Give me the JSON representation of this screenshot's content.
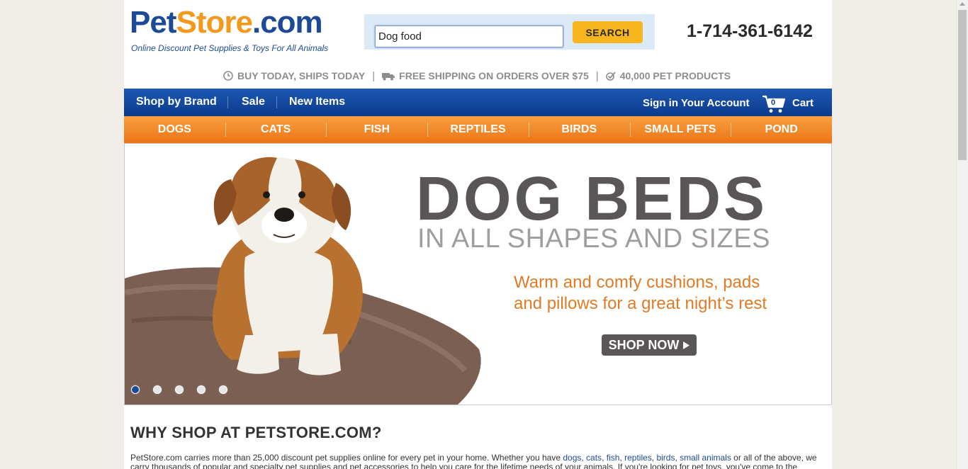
{
  "header": {
    "logo": {
      "pet": "Pet",
      "store": "Store",
      "dotcom": ".com"
    },
    "tagline": "Online Discount Pet Supplies & Toys For All Animals",
    "search": {
      "value": "Dog food",
      "button_label": "SEARCH"
    },
    "phone": "1-714-361-6142"
  },
  "promo": [
    {
      "icon": "clock-icon",
      "label": "BUY TODAY, SHIPS TODAY"
    },
    {
      "icon": "truck-icon",
      "label": "FREE SHIPPING ON ORDERS OVER $75"
    },
    {
      "icon": "checkmark-icon",
      "label": "40,000 PET PRODUCTS"
    }
  ],
  "top_nav": {
    "links": [
      "Shop by Brand",
      "Sale",
      "New Items"
    ],
    "account": "Sign in Your Account",
    "cart_count": "0",
    "cart_label": "Cart"
  },
  "categories": [
    "DOGS",
    "CATS",
    "FISH",
    "REPTILES",
    "BIRDS",
    "SMALL PETS",
    "POND"
  ],
  "hero": {
    "headline": "DOG BEDS",
    "subhead": "IN ALL SHAPES AND SIZES",
    "copy_line1": "Warm and comfy cushions, pads",
    "copy_line2": "and pillows for a great night’s rest",
    "cta": "SHOP NOW",
    "slides_total": 5,
    "active_slide": 1
  },
  "why": {
    "heading": "WHY SHOP AT PETSTORE.COM?",
    "intro": "PetStore.com carries more than 25,000 discount pet supplies online for every pet in your home. Whether you have",
    "links": [
      "dogs",
      "cats",
      "fish",
      "reptiles",
      "birds",
      "small animals"
    ],
    "outro": "or all of the above,",
    "line2": "we carry thousands of popular and specialty pet supplies and pet accessories to help you care for the lifetime needs of your animals. If you're looking for pet toys, you've come to the"
  },
  "colors": {
    "brand_blue": "#1c4a97",
    "brand_orange": "#f39a1e",
    "search_button": "#f7b51e",
    "category_bar": "#ec7414",
    "hero_gray": "#5a5556",
    "hero_orange": "#e07b25"
  }
}
